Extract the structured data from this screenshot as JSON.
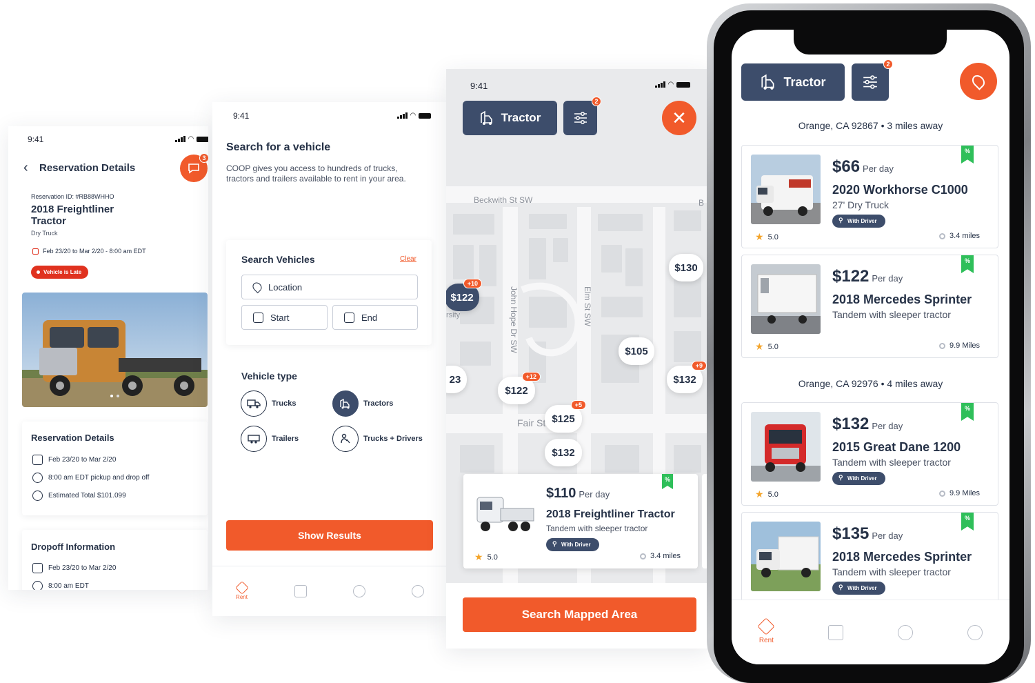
{
  "colors": {
    "accent": "#f15a2b",
    "navy": "#3d4d6b",
    "text": "#263247",
    "green": "#2fbf5a"
  },
  "status_bar": {
    "time": "9:41"
  },
  "reservation": {
    "header_title": "Reservation Details",
    "chat_badge": "3",
    "reservation_id_label": "Reservation ID: #RB88WHHO",
    "vehicle_title_line1": "2018 Freightliner",
    "vehicle_title_line2": "Tractor",
    "vehicle_type": "Dry Truck",
    "date_range": "Feb 23/20  to Mar 2/20 - 8:00 am EDT",
    "late_badge": "Vehicle is Late",
    "details_card": {
      "title": "Reservation Details",
      "dates": "Feb 23/20  to Mar 2/20",
      "time": "8:00 am EDT pickup and drop off",
      "total": "Estimated Total $101.099"
    },
    "dropoff_card": {
      "title": "Dropoff Information",
      "dates": "Feb 23/20  to Mar 2/20",
      "time": "8:00 am EDT"
    }
  },
  "search": {
    "title": "Search for a vehicle",
    "description": "COOP gives you access to hundreds of trucks, tractors and trailers available to rent in your area.",
    "panel_title": "Search Vehicles",
    "clear_link": "Clear",
    "location_placeholder": "Location",
    "start_placeholder": "Start",
    "end_placeholder": "End",
    "vehicle_type_title": "Vehicle type",
    "types": [
      "Trucks",
      "Tractors",
      "Trailers",
      "Trucks + Drivers"
    ],
    "show_results": "Show Results",
    "tab_rent": "Rent"
  },
  "map": {
    "filter_chip": "Tractor",
    "filter_badge": "2",
    "streets": [
      "Beckwith St SW",
      "John Hope Dr SW",
      "Elm St SW",
      "Fair St",
      "B"
    ],
    "partial_label": "rsity",
    "pins": [
      {
        "price": "$122",
        "badge": "+10"
      },
      {
        "price": "$130",
        "badge": ""
      },
      {
        "price": "$105",
        "badge": ""
      },
      {
        "price": "23",
        "badge": ""
      },
      {
        "price": "$122",
        "badge": "+12"
      },
      {
        "price": "$132",
        "badge": "+9"
      },
      {
        "price": "$125",
        "badge": "+5"
      },
      {
        "price": "$132",
        "badge": ""
      }
    ],
    "card": {
      "price": "$110",
      "per_day": "Per day",
      "title": "2018 Freightliner Tractor",
      "subtitle": "Tandem with sleeper tractor",
      "pill": "With Driver",
      "rating": "5.0",
      "distance": "3.4 miles"
    },
    "search_button": "Search Mapped Area"
  },
  "phone": {
    "filter_chip": "Tractor",
    "filter_badge": "2",
    "section1": "Orange, CA 92867 • 3 miles away",
    "section2": "Orange, CA 92976 • 4 miles away",
    "listings": [
      {
        "price": "$66",
        "per_day": "Per day",
        "title": "2020 Workhorse C1000",
        "subtitle": "27' Dry Truck",
        "pill": "With Driver",
        "rating": "5.0",
        "distance": "3.4 miles"
      },
      {
        "price": "$122",
        "per_day": "Per day",
        "title": "2018 Mercedes Sprinter",
        "subtitle": "Tandem with sleeper tractor",
        "pill": "",
        "rating": "5.0",
        "distance": "9.9 Miles"
      },
      {
        "price": "$132",
        "per_day": "Per day",
        "title": "2015 Great Dane 1200",
        "subtitle": "Tandem with sleeper tractor",
        "pill": "With Driver",
        "rating": "5.0",
        "distance": "9.9 Miles"
      },
      {
        "price": "$135",
        "per_day": "Per day",
        "title": "2018 Mercedes Sprinter",
        "subtitle": "Tandem with sleeper tractor",
        "pill": "With Driver",
        "rating": "",
        "distance": ""
      }
    ],
    "tab_rent": "Rent"
  }
}
